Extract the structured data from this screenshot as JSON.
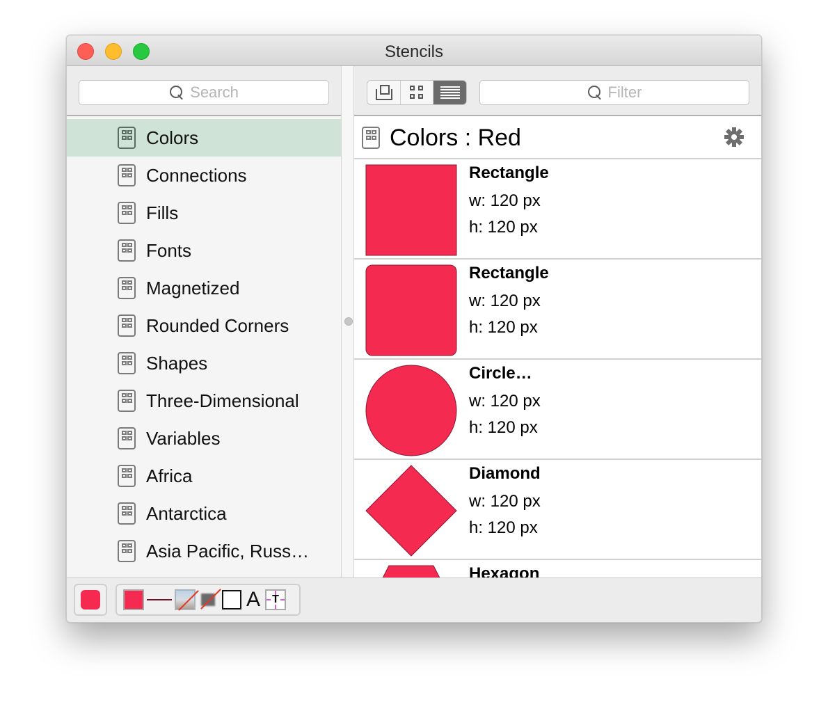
{
  "window": {
    "title": "Stencils",
    "traffic_lights": {
      "close": "#fd5f57",
      "minimize": "#febc2e",
      "maximize": "#28c840"
    }
  },
  "left": {
    "search_placeholder": "Search",
    "search_icon": "magnifier-icon",
    "items": [
      {
        "label": "Colors",
        "selected": true,
        "icon": "stencil-icon"
      },
      {
        "label": "Connections",
        "icon": "stencil-icon"
      },
      {
        "label": "Fills",
        "icon": "stencil-icon"
      },
      {
        "label": "Fonts",
        "icon": "stencil-icon"
      },
      {
        "label": "Magnetized",
        "icon": "stencil-icon"
      },
      {
        "label": "Rounded Corners",
        "icon": "stencil-icon"
      },
      {
        "label": "Shapes",
        "icon": "stencil-icon"
      },
      {
        "label": "Three-Dimensional",
        "icon": "stencil-icon"
      },
      {
        "label": "Variables",
        "icon": "stencil-icon"
      },
      {
        "label": "Africa",
        "icon": "stencil-icon"
      },
      {
        "label": "Antarctica",
        "icon": "stencil-icon"
      },
      {
        "label": "Asia Pacific, Russ…",
        "icon": "stencil-icon"
      }
    ],
    "selected_color": "#d0e3d7"
  },
  "right": {
    "view_modes": [
      {
        "name": "canvas-view",
        "icon": "stacked-squares-icon",
        "active": false
      },
      {
        "name": "grid-view",
        "icon": "grid-icon",
        "active": false
      },
      {
        "name": "list-view",
        "icon": "list-icon",
        "active": true
      }
    ],
    "filter_placeholder": "Filter",
    "header_title": "Colors : Red",
    "header_icon": "stencil-icon",
    "settings_icon": "gear-icon",
    "shapes": [
      {
        "name": "Rectangle",
        "w": "w: 120 px",
        "h": "h: 120 px",
        "kind": "rect"
      },
      {
        "name": "Rectangle",
        "w": "w: 120 px",
        "h": "h: 120 px",
        "kind": "rounded-rect"
      },
      {
        "name": "Circle…",
        "w": "w: 120 px",
        "h": "h: 120 px",
        "kind": "circle"
      },
      {
        "name": "Diamond",
        "w": "w: 120 px",
        "h": "h: 120 px",
        "kind": "diamond"
      },
      {
        "name": "Hexagon",
        "w": "",
        "h": "",
        "kind": "hexagon"
      }
    ],
    "shape_fill": "#f42a50",
    "shape_stroke": "#8a1830"
  },
  "bottom": {
    "current_color": "#f42a50",
    "style_fill": "#f42a50",
    "style_stroke": "#7a1028",
    "text_letter": "A",
    "text_position_letter": "T"
  }
}
